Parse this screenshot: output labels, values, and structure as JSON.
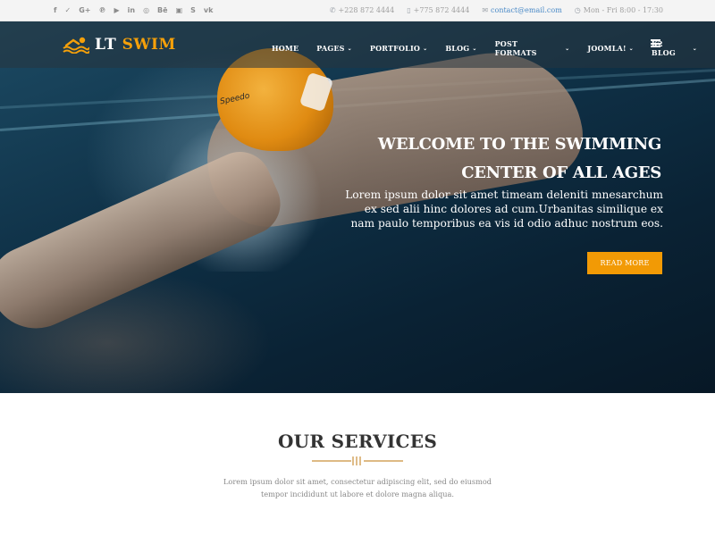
{
  "topbar": {
    "social": [
      {
        "icon": "facebook-icon",
        "glyph": "f"
      },
      {
        "icon": "twitter-icon",
        "glyph": "✓"
      },
      {
        "icon": "google-plus-icon",
        "glyph": "G+"
      },
      {
        "icon": "pinterest-icon",
        "glyph": "℗"
      },
      {
        "icon": "youtube-icon",
        "glyph": "▶"
      },
      {
        "icon": "linkedin-icon",
        "glyph": "in"
      },
      {
        "icon": "dribbble-icon",
        "glyph": "◎"
      },
      {
        "icon": "behance-icon",
        "glyph": "Bē"
      },
      {
        "icon": "flickr-icon",
        "glyph": "▣"
      },
      {
        "icon": "skype-icon",
        "glyph": "S"
      },
      {
        "icon": "vk-icon",
        "glyph": "vk"
      }
    ],
    "phone1": "+228 872 4444",
    "phone2": "+775 872 4444",
    "email": "contact@email.com",
    "hours": "Mon - Fri 8:00 - 17:30"
  },
  "header": {
    "logo_word1": "LT",
    "logo_word2": "SWIM",
    "menu": [
      {
        "label": "HOME",
        "dropdown": false
      },
      {
        "label": "PAGES",
        "dropdown": true
      },
      {
        "label": "PORTFOLIO",
        "dropdown": true
      },
      {
        "label": "BLOG",
        "dropdown": true
      },
      {
        "label": "POST FORMATS",
        "dropdown": true
      },
      {
        "label": "JOOMLA!",
        "dropdown": true
      },
      {
        "label": "K2 BLOG",
        "dropdown": true
      }
    ]
  },
  "hero": {
    "title_line1": "WELCOME TO THE SWIMMING",
    "title_line2": "CENTER OF ALL AGES",
    "description": "Lorem ipsum dolor sit amet timeam deleniti mnesarchum ex sed alii hinc dolores ad cum.Urbanitas similique ex nam paulo temporibus ea vis id odio adhuc nostrum eos.",
    "cap_brand": "Speedo",
    "button_label": "READ MORE"
  },
  "services": {
    "title": "OUR SERVICES",
    "text_line1": "Lorem ipsum dolor sit amet, consectetur adipiscing elit, sed do eiusmod",
    "text_line2": "tempor incididunt ut labore et dolore magna aliqua."
  },
  "colors": {
    "accent": "#f29a05",
    "link": "#4a8ac7"
  }
}
